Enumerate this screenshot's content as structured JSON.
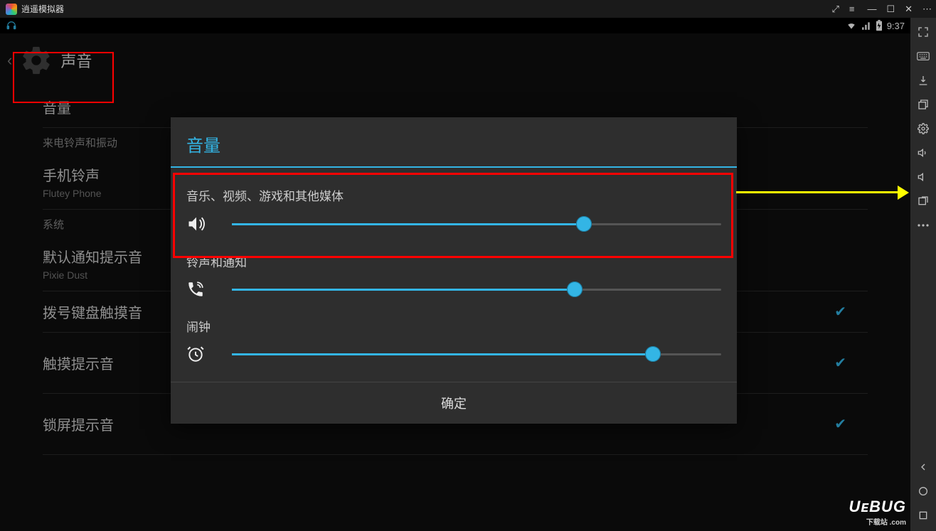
{
  "titlebar": {
    "app_name": "逍遥模拟器"
  },
  "status_bar": {
    "time": "9:37"
  },
  "settings": {
    "page_title": "声音",
    "volume_label": "音量",
    "category_ringtone": "来电铃声和振动",
    "phone_ringtone": {
      "primary": "手机铃声",
      "secondary": "Flutey Phone"
    },
    "category_system": "系统",
    "default_notification": {
      "primary": "默认通知提示音",
      "secondary": "Pixie Dust"
    },
    "dial_pad_touch": "拨号键盘触摸音",
    "touch_sound": "触摸提示音",
    "lock_sound": "锁屏提示音"
  },
  "dialog": {
    "title": "音量",
    "media": {
      "label": "音乐、视频、游戏和其他媒体",
      "percent": 72
    },
    "ringtone": {
      "label": "铃声和通知",
      "percent": 70
    },
    "alarm": {
      "label": "闹钟",
      "percent": 86
    },
    "confirm": "确定"
  },
  "watermark": {
    "brand": "UᴇBUG",
    "sub": "下载站 .com"
  }
}
